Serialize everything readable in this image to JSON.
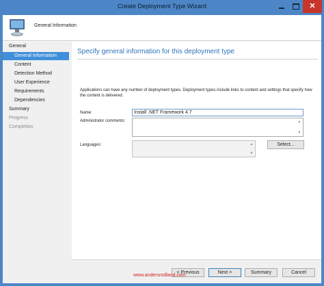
{
  "window": {
    "title": "Create Deployment Type Wizard",
    "close_glyph": "✕",
    "title_bar_color": "#4d86c6",
    "close_color": "#c6362a"
  },
  "header": {
    "icon": "computer-icon",
    "title": "General Information"
  },
  "sidebar": {
    "selected_color": "#3f8fda",
    "items": [
      {
        "label": "General",
        "state": "normal"
      },
      {
        "label": "General Information",
        "state": "selected"
      },
      {
        "label": "Content",
        "state": "normal"
      },
      {
        "label": "Detection Method",
        "state": "normal"
      },
      {
        "label": "User Experience",
        "state": "normal"
      },
      {
        "label": "Requirements",
        "state": "normal"
      },
      {
        "label": "Dependencies",
        "state": "normal"
      },
      {
        "label": "Summary",
        "state": "normal"
      },
      {
        "label": "Progress",
        "state": "disabled"
      },
      {
        "label": "Completion",
        "state": "disabled"
      }
    ]
  },
  "main": {
    "heading": "Specify general information for this deployment type",
    "heading_color": "#2e73bb",
    "description": "Applications can have any number of deployment types. Deployment types include links to content and settings that specify how the content is delivered.",
    "name_label": "Name:",
    "name_value": "Install .NET Framework 4.7",
    "comments_label": "Administrator comments:",
    "comments_value": "",
    "languages_label": "Languages:",
    "languages_value": "",
    "select_button": "Select..."
  },
  "watermark": {
    "text": "www.andersrodland.com",
    "color": "#d21f1f"
  },
  "footer": {
    "previous": "< Previous",
    "next": "Next >",
    "summary": "Summary",
    "cancel": "Cancel"
  }
}
